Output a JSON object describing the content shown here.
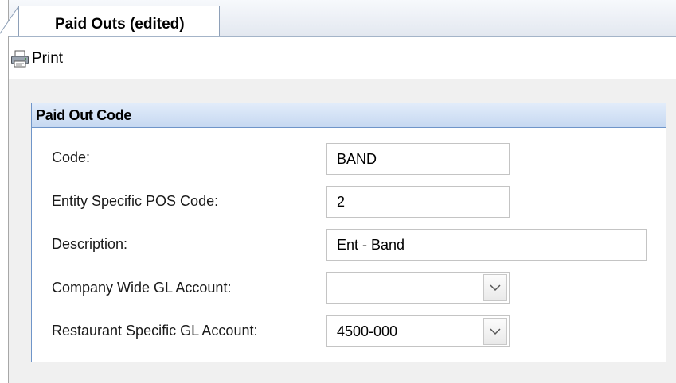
{
  "tab": {
    "label": "Paid Outs (edited)"
  },
  "toolbar": {
    "print_label": "Print"
  },
  "group": {
    "title": "Paid Out Code",
    "fields": [
      {
        "label": "Code:",
        "value": "BAND",
        "type": "text"
      },
      {
        "label": "Entity Specific POS Code:",
        "value": "2",
        "type": "text"
      },
      {
        "label": "Description:",
        "value": "Ent - Band",
        "type": "text"
      },
      {
        "label": "Company Wide GL Account:",
        "value": "",
        "type": "combo"
      },
      {
        "label": "Restaurant Specific GL Account:",
        "value": "4500-000",
        "type": "combo"
      }
    ]
  },
  "icons": {
    "print": "printer-icon",
    "combo": "chevron-down-icon"
  }
}
